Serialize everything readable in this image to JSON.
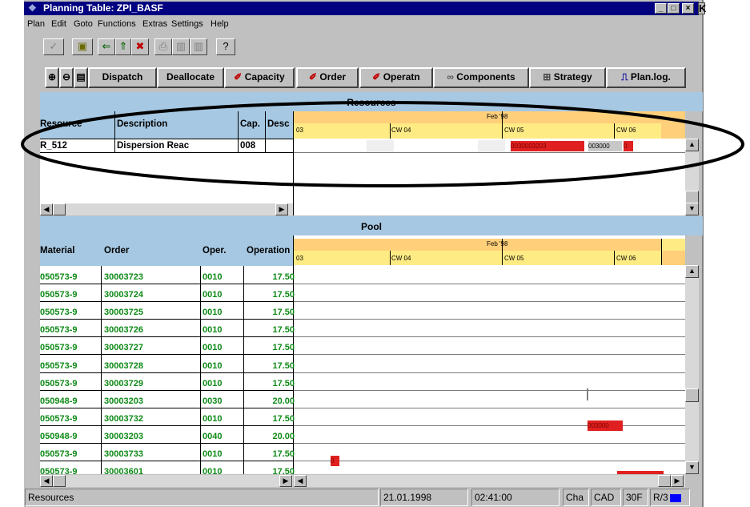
{
  "window": {
    "title": "Planning Table: ZPI_BASF",
    "min": "_",
    "max": "□",
    "close": "×",
    "extra": "K"
  },
  "menu": [
    "Plan",
    "Edit",
    "Goto",
    "Functions",
    "Extras",
    "Settings",
    "Help"
  ],
  "toolbar_buttons": [
    "Dispatch",
    "Deallocate",
    "Capacity",
    "Order",
    "Operatn",
    "Components",
    "Strategy",
    "Plan.log."
  ],
  "resources": {
    "title": "Resources",
    "col_resource": "Resource",
    "col_description": "Description",
    "col_cap": "Cap.",
    "col_desc2": "Desc",
    "row": {
      "resource": "R_512",
      "description": "Dispersion Reac",
      "cap": "008"
    },
    "month": "Feb '98",
    "week_prev": "03",
    "week1": "CW 04",
    "week2": "CW 05",
    "week3": "CW 06",
    "bar1": "0030003203",
    "bar2": "003000",
    "bar3": "0"
  },
  "pool": {
    "title": "Pool",
    "col_material": "Material",
    "col_order": "Order",
    "col_oper": "Oper.",
    "col_operation": "Operation",
    "month": "Feb '98",
    "week_prev": "03",
    "week1": "CW 04",
    "week2": "CW 05",
    "week3": "CW 06",
    "rows": [
      {
        "material": "050573-9",
        "order": "30003723",
        "oper": "0010",
        "value": "17.50"
      },
      {
        "material": "050573-9",
        "order": "30003724",
        "oper": "0010",
        "value": "17.50"
      },
      {
        "material": "050573-9",
        "order": "30003725",
        "oper": "0010",
        "value": "17.50"
      },
      {
        "material": "050573-9",
        "order": "30003726",
        "oper": "0010",
        "value": "17.50"
      },
      {
        "material": "050573-9",
        "order": "30003727",
        "oper": "0010",
        "value": "17.50"
      },
      {
        "material": "050573-9",
        "order": "30003728",
        "oper": "0010",
        "value": "17.50"
      },
      {
        "material": "050573-9",
        "order": "30003729",
        "oper": "0010",
        "value": "17.50"
      },
      {
        "material": "050948-9",
        "order": "30003203",
        "oper": "0030",
        "value": "20.00"
      },
      {
        "material": "050573-9",
        "order": "30003732",
        "oper": "0010",
        "value": "17.50"
      },
      {
        "material": "050948-9",
        "order": "30003203",
        "oper": "0040",
        "value": "20.00"
      },
      {
        "material": "050573-9",
        "order": "30003733",
        "oper": "0010",
        "value": "17.50"
      },
      {
        "material": "050573-9",
        "order": "30003601",
        "oper": "0010",
        "value": "17.50"
      }
    ],
    "bar_row10": "003000",
    "bar_row12": "0"
  },
  "status": {
    "panel": "Resources",
    "date": "21.01.1998",
    "time": "02:41:00",
    "mode": "Cha",
    "sys": "CAD",
    "client": "30F",
    "r3": "R/3"
  }
}
